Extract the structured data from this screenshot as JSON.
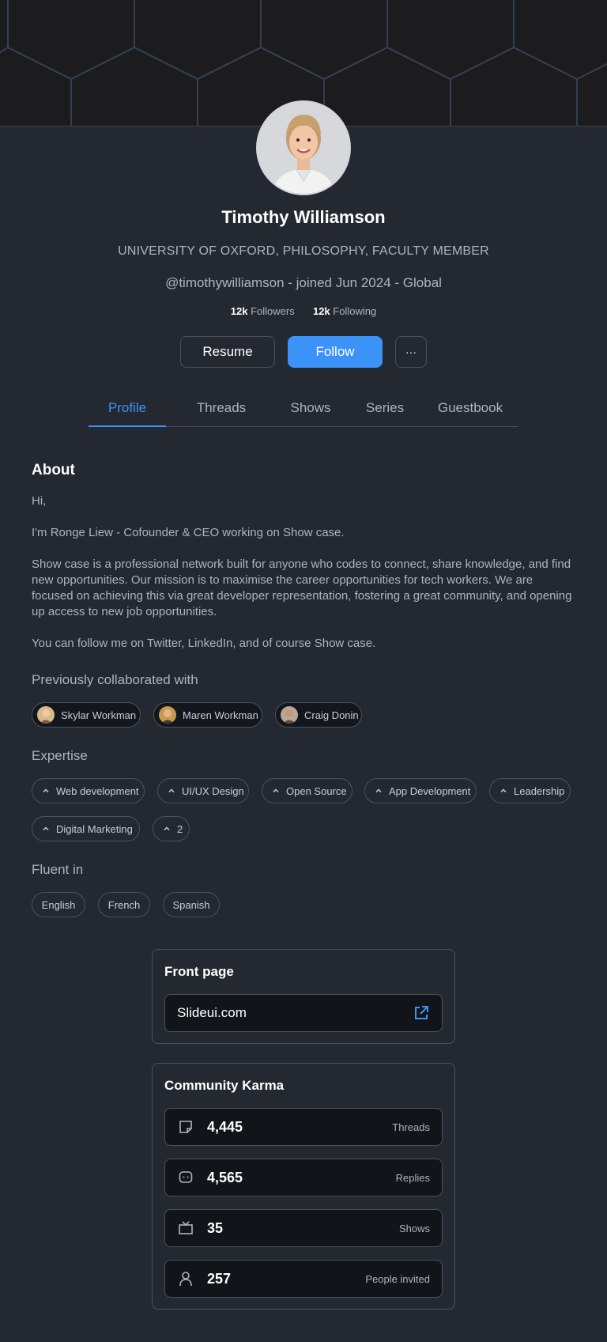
{
  "profile": {
    "name": "Timothy Williamson",
    "role": "UNIVERSITY OF OXFORD, PHILOSOPHY, FACULTY MEMBER",
    "handle_line": "@timothywilliamson - joined Jun 2024 - Global",
    "followers_count": "12k",
    "followers_label": "Followers",
    "following_count": "12k",
    "following_label": "Following"
  },
  "actions": {
    "resume": "Resume",
    "follow": "Follow",
    "more": "···"
  },
  "tabs": [
    {
      "label": "Profile",
      "active": true
    },
    {
      "label": "Threads"
    },
    {
      "label": "Shows"
    },
    {
      "label": "Series"
    },
    {
      "label": "Guestbook"
    }
  ],
  "about": {
    "title": "About",
    "p1": "Hi,",
    "p2": "I'm Ronge Liew - Cofounder & CEO working on Show case.",
    "p3": "Show case is a professional network built for anyone who codes to connect, share knowledge, and find new opportunities. Our mission is to maximise the career opportunities for tech workers. We are focused on achieving this via great developer representation, fostering a great community, and opening up access to new job opportunities.",
    "p4": "You can follow me on Twitter, LinkedIn, and of course Show case."
  },
  "collaborated": {
    "title": "Previously collaborated with",
    "people": [
      "Skylar Workman",
      "Maren Workman",
      "Craig Donin"
    ]
  },
  "expertise": {
    "title": "Expertise",
    "items": [
      "Web development",
      "UI/UX Design",
      "Open Source",
      "App Development",
      "Leadership",
      "Digital Marketing",
      "2"
    ]
  },
  "fluent": {
    "title": "Fluent in",
    "languages": [
      "English",
      "French",
      "Spanish"
    ]
  },
  "front_page": {
    "title": "Front page",
    "url": "Slideui.com"
  },
  "karma": {
    "title": "Community Karma",
    "rows": [
      {
        "value": "4,445",
        "label": "Threads",
        "icon": "note-icon"
      },
      {
        "value": "4,565",
        "label": "Replies",
        "icon": "chat-bubble-icon"
      },
      {
        "value": "35",
        "label": "Shows",
        "icon": "tv-icon"
      },
      {
        "value": "257",
        "label": "People invited",
        "icon": "user-icon"
      }
    ]
  },
  "colors": {
    "accent": "#3b93f8",
    "background": "#242830",
    "surface": "#111419",
    "border": "#4b515c"
  }
}
